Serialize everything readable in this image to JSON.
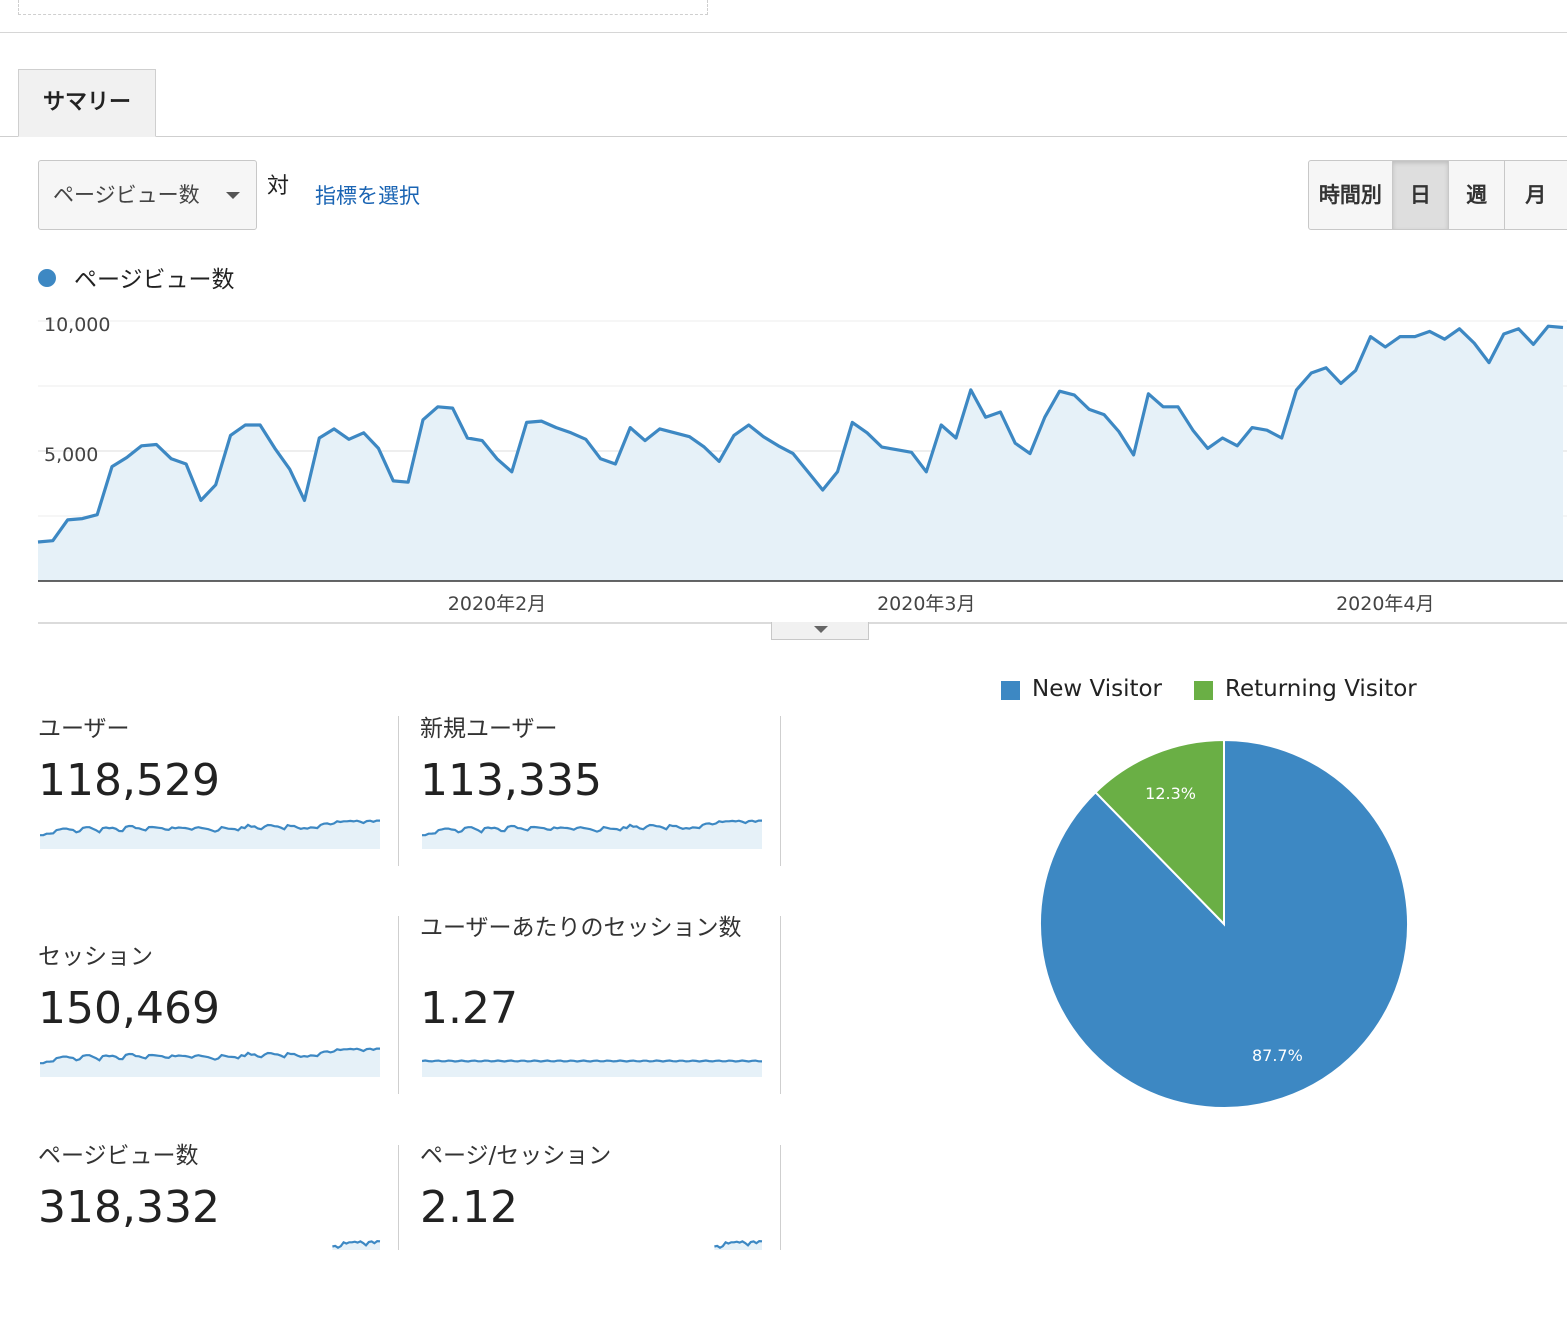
{
  "tabs": {
    "summary": "サマリー"
  },
  "controls": {
    "metric_dropdown": "ページビュー数",
    "vs_label": "対",
    "select_metric": "指標を選択",
    "periods": [
      "時間別",
      "日",
      "週",
      "月"
    ],
    "active_period": "日"
  },
  "colors": {
    "accent": "#3d88c3",
    "fill": "#e6f1f8",
    "new_visitor": "#3d88c3",
    "returning_visitor": "#6aaf45"
  },
  "chart_data": [
    {
      "type": "area",
      "legend": "ページビュー数",
      "y_ticks": [
        "10,000",
        "5,000"
      ],
      "x_ticks": [
        "2020年2月",
        "2020年3月",
        "2020年4月"
      ],
      "ylim": [
        0,
        10000
      ],
      "series": [
        {
          "name": "ページビュー数",
          "values": [
            1500,
            1550,
            2350,
            2400,
            2550,
            4400,
            4750,
            5200,
            5250,
            4700,
            4500,
            3100,
            3700,
            5600,
            6000,
            6000,
            5100,
            4300,
            3100,
            5500,
            5850,
            5450,
            5700,
            5100,
            3850,
            3800,
            6200,
            6700,
            6650,
            5500,
            5400,
            4700,
            4200,
            6100,
            6150,
            5900,
            5700,
            5450,
            4700,
            4500,
            5900,
            5400,
            5850,
            5700,
            5550,
            5150,
            4600,
            5600,
            6000,
            5550,
            5200,
            4900,
            4200,
            3500,
            4200,
            6100,
            5700,
            5150,
            5050,
            4950,
            4200,
            6000,
            5500,
            7350,
            6300,
            6500,
            5300,
            4900,
            6300,
            7300,
            7150,
            6600,
            6400,
            5750,
            4850,
            7200,
            6700,
            6700,
            5800,
            5100,
            5500,
            5200,
            5900,
            5800,
            5500,
            7350,
            8000,
            8200,
            7600,
            8100,
            9400,
            9000,
            9400,
            9400,
            9600,
            9300,
            9700,
            9150,
            8400,
            9500,
            9700,
            9100,
            9800,
            9750
          ]
        }
      ]
    },
    {
      "type": "pie",
      "legend": [
        "New Visitor",
        "Returning Visitor"
      ],
      "values": [
        87.7,
        12.3
      ],
      "labels": [
        "87.7%",
        "12.3%"
      ]
    }
  ],
  "kpis": [
    {
      "label": "ユーザー",
      "value": "118,529",
      "spark": "trend"
    },
    {
      "label": "新規ユーザー",
      "value": "113,335",
      "spark": "trend"
    },
    {
      "label": "セッション",
      "value": "150,469",
      "spark": "trend"
    },
    {
      "label": "ユーザーあたりのセッション数",
      "value": "1.27",
      "spark": "flat"
    },
    {
      "label": "ページビュー数",
      "value": "318,332",
      "spark": "cut"
    },
    {
      "label": "ページ/セッション",
      "value": "2.12",
      "spark": "cut"
    }
  ]
}
